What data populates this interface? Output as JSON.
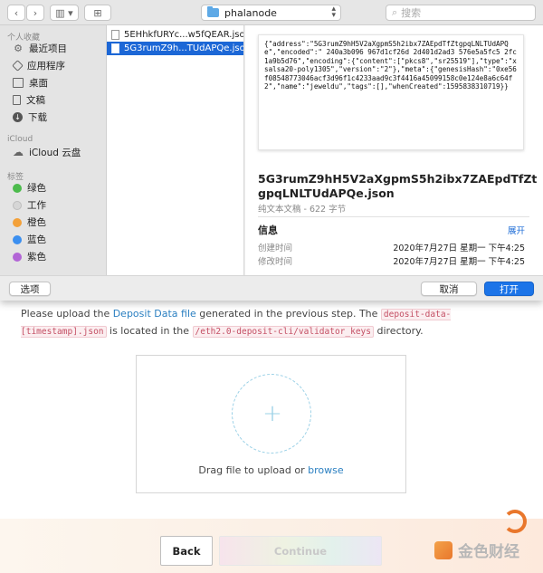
{
  "dialog": {
    "toolbar": {
      "back_glyph": "‹",
      "forward_glyph": "›",
      "view_glyph": "▥ ▾",
      "new_folder_glyph": "⊞",
      "path": "phalanode",
      "search_placeholder": "搜索"
    },
    "sidebar": {
      "favorites_heading": "个人收藏",
      "favorites": [
        {
          "label": "最近项目",
          "icon": "recents-icon"
        },
        {
          "label": "应用程序",
          "icon": "applications-icon"
        },
        {
          "label": "桌面",
          "icon": "desktop-icon"
        },
        {
          "label": "文稿",
          "icon": "documents-icon"
        },
        {
          "label": "下载",
          "icon": "downloads-icon"
        }
      ],
      "icloud_heading": "iCloud",
      "icloud_item": "iCloud 云盘",
      "tags_heading": "标签",
      "tags": [
        {
          "label": "绿色",
          "color": "#4cbb4c"
        },
        {
          "label": "工作",
          "color": "#d6d6d6"
        },
        {
          "label": "橙色",
          "color": "#f3a13a"
        },
        {
          "label": "蓝色",
          "color": "#3b8ff0"
        },
        {
          "label": "紫色",
          "color": "#b265d6"
        }
      ]
    },
    "files": [
      {
        "name": "5EHhkfURYc...w5fQEAR.json",
        "selected": false
      },
      {
        "name": "5G3rumZ9h...TUdAPQe.json",
        "selected": true
      }
    ],
    "preview": {
      "json_text": "{\"address\":\"5G3rumZ9hH5V2aXgpmS5h2ibx7ZAEpdTfZtgpqLNLTUdAPQe\",\"encoded\":\"                                                 240a3b096                                                 967d1cf26d                                                 2d401d2ad3                                                 576e5a5fc5                                                 2fc1a9b5d76\",\"encoding\":{\"content\":[\"pkcs8\",\"sr25519\"],\"type\":\"xsalsa20-poly1305\",\"version\":\"2\"},\"meta\":{\"genesisHash\":\"0xe56f08548773046acf3d96f1c4233aad9c3f4416a45099158c0e124e8a6c64f2\",\"name\":\"jeweldu\",\"tags\":[],\"whenCreated\":1595838310719}}",
      "file_name": "5G3rumZ9hH5V2aXgpmS5h2ibx7ZAEpdTfZtgpqLNLTUdAPQe.json",
      "kind": "纯文本文稿 - 622 字节",
      "info_heading": "信息",
      "more_label": "展开",
      "created_label": "创建时间",
      "created_value": "2020年7月27日 星期一 下午4:25",
      "modified_label": "修改时间",
      "modified_value": "2020年7月27日 星期一 下午4:25"
    },
    "buttons": {
      "options": "选项",
      "cancel": "取消",
      "open": "打开"
    }
  },
  "page": {
    "instruction_1": "Please upload the ",
    "link_deposit": "Deposit Data file",
    "instruction_2": " generated in the previous step. The ",
    "code_1": "deposit-data-[timestamp].json",
    "instruction_3": " is located in the ",
    "code_2": "/eth2.0-deposit-cli/validator_keys",
    "instruction_4": " directory.",
    "dropzone_text": "Drag file to upload or ",
    "dropzone_link": "browse",
    "dropzone_glyph": "+",
    "back_label": "Back",
    "continue_label": "Continue",
    "watermark": "金色财经"
  }
}
